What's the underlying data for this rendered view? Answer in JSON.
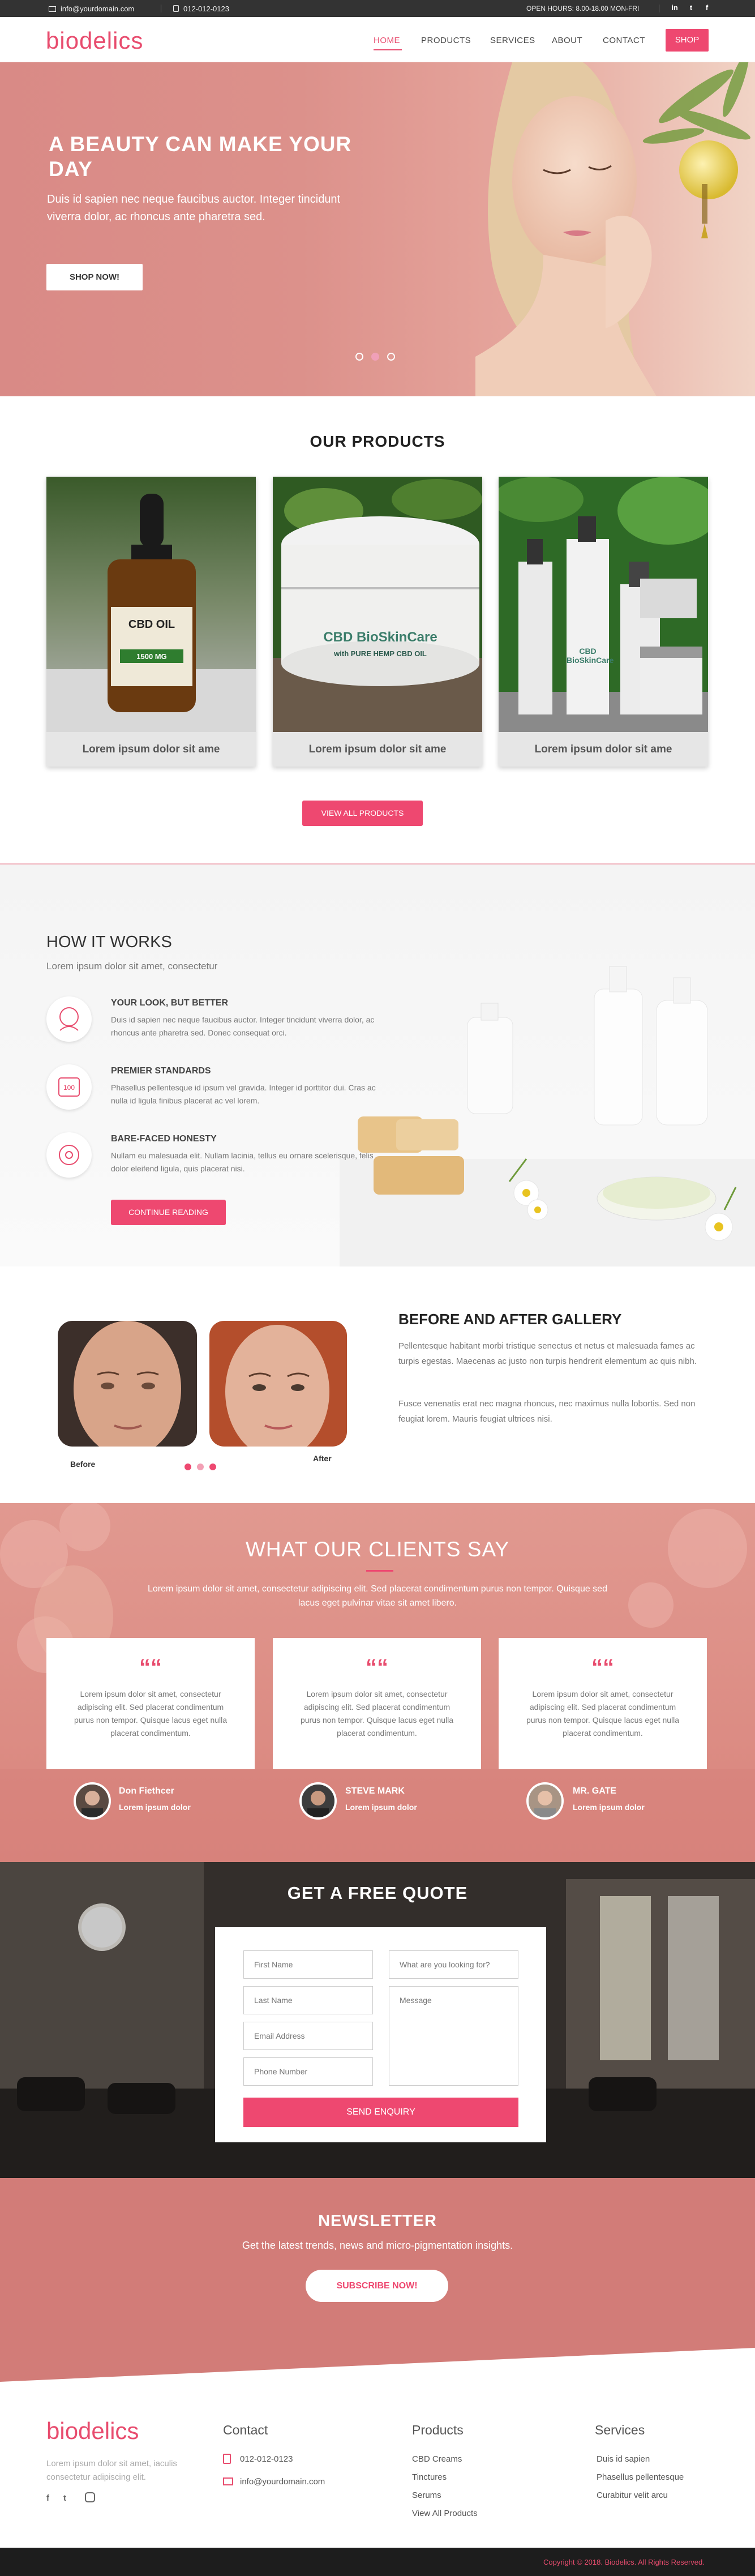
{
  "topbar": {
    "email": "info@yourdomain.com",
    "phone": "012-012-0123",
    "hours": "OPEN HOURS: 8.00-18.00 MON-FRI",
    "social": [
      "in",
      "t",
      "f"
    ]
  },
  "header": {
    "logo": "biodelics",
    "nav": [
      "HOME",
      "PRODUCTS",
      "SERVICES",
      "ABOUT",
      "CONTACT"
    ],
    "active_nav": "HOME",
    "shop": "SHOP"
  },
  "hero": {
    "title": "A BEAUTY CAN MAKE YOUR DAY",
    "subtitle": "Duis id sapien nec neque faucibus auctor. Integer tincidunt viverra dolor, ac rhoncus ante pharetra sed.",
    "button": "SHOP NOW!",
    "slides": 3,
    "active_slide": 2
  },
  "products": {
    "title": "OUR PRODUCTS",
    "items": [
      {
        "caption": "Lorem ipsum dolor sit ame",
        "label_a": "CBD OIL",
        "label_b": "1500 MG"
      },
      {
        "caption": "Lorem ipsum dolor sit ame",
        "label_a": "CBD BioSkinCare",
        "label_b": "with PURE HEMP CBD OIL"
      },
      {
        "caption": "Lorem ipsum dolor sit ame",
        "label_a": "CBD BioSkinCare",
        "label_b": ""
      }
    ],
    "view_all": "VIEW ALL PRODUCTS"
  },
  "how": {
    "title": "HOW IT WORKS",
    "subtitle": "Lorem ipsum dolor sit amet, consectetur",
    "features": [
      {
        "icon": "face-icon",
        "title": "YOUR LOOK, BUT BETTER",
        "text": "Duis id sapien nec neque faucibus auctor. Integer tincidunt viverra dolor, ac rhoncus ante pharetra sed. Donec consequat orci."
      },
      {
        "icon": "badge-100-icon",
        "title": "PREMIER STANDARDS",
        "text": "Phasellus pellentesque id ipsum vel gravida. Integer id porttitor dui. Cras ac nulla id ligula finibus placerat ac vel lorem."
      },
      {
        "icon": "face-care-icon",
        "title": "BARE-FACED HONESTY",
        "text": "Nullam eu malesuada elit. Nullam lacinia, tellus eu ornare scelerisque, felis dolor eleifend ligula, quis placerat nisi."
      }
    ],
    "button": "CONTINUE READING"
  },
  "gallery": {
    "title": "BEFORE AND AFTER GALLERY",
    "p1": "Pellentesque habitant morbi tristique senectus et netus et malesuada fames ac turpis egestas. Maecenas ac justo non turpis hendrerit elementum ac quis nibh.",
    "p2": "Fusce venenatis erat nec magna rhoncus, nec maximus nulla lobortis. Sed non feugiat lorem. Mauris feugiat ultrices nisi.",
    "before": "Before",
    "after": "After",
    "dots": 3
  },
  "testimonials": {
    "title": "WHAT OUR CLIENTS SAY",
    "subtitle": "Lorem ipsum dolor sit amet, consectetur adipiscing elit. Sed placerat condimentum purus non tempor. Quisque sed lacus eget pulvinar vitae sit amet libero.",
    "quote_mark": "““",
    "items": [
      {
        "text": "Lorem ipsum dolor sit amet, consectetur adipiscing elit. Sed placerat condimentum purus non tempor. Quisque lacus eget nulla placerat condimentum.",
        "name": "Don Fiethcer",
        "role": "Lorem ipsum dolor"
      },
      {
        "text": "Lorem ipsum dolor sit amet, consectetur adipiscing elit. Sed placerat condimentum purus non tempor. Quisque lacus eget nulla placerat condimentum.",
        "name": "STEVE MARK",
        "role": "Lorem ipsum dolor"
      },
      {
        "text": "Lorem ipsum dolor sit amet, consectetur adipiscing elit. Sed placerat condimentum purus non tempor. Quisque lacus eget nulla placerat condimentum.",
        "name": "MR. GATE",
        "role": "Lorem ipsum dolor"
      }
    ]
  },
  "quote": {
    "title": "GET A FREE QUOTE",
    "first_name": "First Name",
    "last_name": "Last Name",
    "email": "Email Address",
    "phone": "Phone Number",
    "looking_for": "What are you looking for?",
    "message": "Message",
    "button": "SEND ENQUIRY"
  },
  "newsletter": {
    "title": "NEWSLETTER",
    "subtitle": "Get the latest trends, news and micro-pigmentation insights.",
    "button": "SUBSCRIBE NOW!"
  },
  "footer": {
    "logo": "biodelics",
    "about": "Lorem ipsum dolor sit amet, iaculis consectetur adipiscing elit.",
    "social": [
      "f",
      "t",
      "ig"
    ],
    "contact_title": "Contact",
    "phone": "012-012-0123",
    "email": "info@yourdomain.com",
    "products_title": "Products",
    "products": [
      "CBD Creams",
      "Tinctures",
      "Serums",
      "View All Products"
    ],
    "services_title": "Services",
    "services": [
      "Duis id sapien",
      "Phasellus pellentesque",
      "Curabitur velit arcu"
    ],
    "copyright": "Copyright © 2018. Biodelics. All Rights Reserved."
  },
  "colors": {
    "accent": "#ee4870",
    "brand_pink": "#e84c6e",
    "hero_bg": "#d98a86",
    "testimonial_bg": "#dd8f86",
    "newsletter_bg": "#d27c78"
  }
}
